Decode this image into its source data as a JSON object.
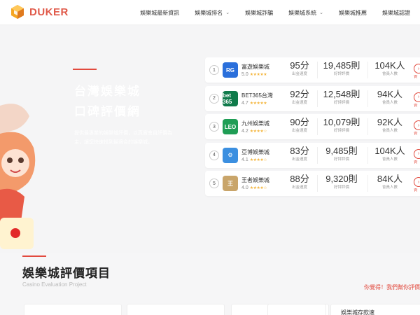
{
  "header": {
    "brand": "DUKER",
    "nav": [
      {
        "label": "娛樂城最新資訊",
        "dropdown": false
      },
      {
        "label": "娛樂城排名",
        "dropdown": true
      },
      {
        "label": "娛樂城詐騙",
        "dropdown": false
      },
      {
        "label": "娛樂城系統",
        "dropdown": true
      },
      {
        "label": "娛樂城推薦",
        "dropdown": false
      },
      {
        "label": "娛樂城認證",
        "dropdown": false
      }
    ]
  },
  "hero": {
    "title_line1": "台灣娛樂城",
    "title_line2": "口碑評價網",
    "description": "提供最專業的娛樂城評價，以真實會員評價為主，讓您快速找到最適合的娛樂城。"
  },
  "ranking": {
    "rows": [
      {
        "rank": "1",
        "icon_text": "RG",
        "icon_color": "#2a6fdb",
        "name": "富遊娛樂城",
        "rating": "5.0",
        "stars": "★★★★★",
        "score": "95分",
        "score_label": "出金速度",
        "reviews": "19,485則",
        "reviews_label": "好評評價",
        "members": "104K人",
        "members_label": "會員人數",
        "cta": "官"
      },
      {
        "rank": "2",
        "icon_text": "bet 365",
        "icon_color": "#0f7a4a",
        "name": "BET365台灣",
        "rating": "4.7",
        "stars": "★★★★★",
        "score": "92分",
        "score_label": "出金速度",
        "reviews": "12,548則",
        "reviews_label": "好評評價",
        "members": "94K人",
        "members_label": "會員人數",
        "cta": "官"
      },
      {
        "rank": "3",
        "icon_text": "LEO",
        "icon_color": "#1f9d55",
        "name": "九州娛樂城",
        "rating": "4.2",
        "stars": "★★★★☆",
        "score": "90分",
        "score_label": "出金速度",
        "reviews": "10,079則",
        "reviews_label": "好評評價",
        "members": "92K人",
        "members_label": "會員人數",
        "cta": "官"
      },
      {
        "rank": "4",
        "icon_text": "⚙",
        "icon_color": "#3b8fe0",
        "name": "亞博娛樂城",
        "rating": "4.1",
        "stars": "★★★★☆",
        "score": "83分",
        "score_label": "出金速度",
        "reviews": "9,485則",
        "reviews_label": "好評評價",
        "members": "104K人",
        "members_label": "會員人數",
        "cta": "官"
      },
      {
        "rank": "5",
        "icon_text": "王",
        "icon_color": "#c9a56a",
        "name": "王者娛樂城",
        "rating": "4.0",
        "stars": "★★★★☆",
        "score": "88分",
        "score_label": "出金速度",
        "reviews": "9,320則",
        "reviews_label": "好評評價",
        "members": "84K人",
        "members_label": "會員人數",
        "cta": "官"
      }
    ]
  },
  "section": {
    "title": "娛樂城評價項目",
    "subtitle": "Casino Evaluation Project",
    "link": "你覺得！我們幫你評價"
  },
  "cards": [
    {
      "label": ""
    },
    {
      "label": ""
    },
    {
      "label": ""
    },
    {
      "label": ""
    },
    {
      "label": "娛樂城存款速"
    }
  ]
}
